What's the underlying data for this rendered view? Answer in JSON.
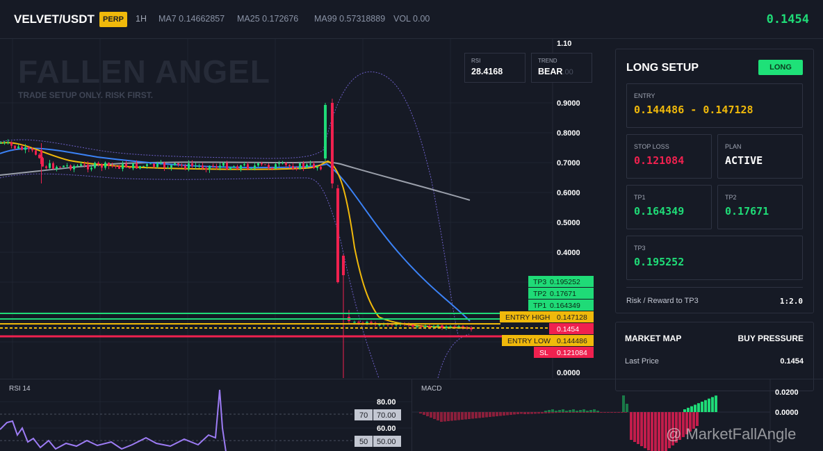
{
  "header": {
    "symbol": "VELVET/USDT",
    "badge": "PERP",
    "timeframe": "1H",
    "ma7": "MA7 0.14662857",
    "ma25": "MA25 0.172676",
    "ma99": "MA99 0.57318889",
    "vol": "VOL 0.00",
    "last_price": "0.1454"
  },
  "chart": {
    "watermark_title": "FALLEN ANGEL",
    "watermark_subtitle": "TRADE SETUP ONLY. RISK FIRST.",
    "rsi_box": {
      "label": "RSI",
      "value": "28.4168"
    },
    "trend_box": {
      "label": "TREND",
      "value": "BEAR",
      "ghost_tick": ".00"
    },
    "price_axis": [
      "1.10",
      "0.9000",
      "0.8000",
      "0.7000",
      "0.6000",
      "0.5000",
      "0.4000",
      "0.0000"
    ],
    "levels": {
      "tp3": {
        "tag": "TP3",
        "value": "0.195252",
        "price": 0.195252
      },
      "tp2": {
        "tag": "TP2",
        "value": "0.17671",
        "price": 0.17671
      },
      "tp1": {
        "tag": "TP1",
        "value": "0.164349",
        "price": 0.164349
      },
      "entry_high": {
        "tag": "ENTRY HIGH",
        "value": "0.147128",
        "price": 0.147128
      },
      "last": {
        "value": "0.1454",
        "price": 0.1454
      },
      "entry_low": {
        "tag": "ENTRY LOW",
        "value": "0.144486",
        "price": 0.144486
      },
      "sl": {
        "tag": "SL",
        "value": "0.121084",
        "price": 0.121084
      }
    },
    "colors": {
      "up": "#1fdb77",
      "down": "#f0214f",
      "ma7": "#f0b90b",
      "ma25": "#3b82f6",
      "ma99": "#9ba0ab",
      "boll": "#6c5fc7"
    }
  },
  "setup": {
    "title": "LONG SETUP",
    "direction_badge": "LONG",
    "entry_label": "ENTRY",
    "entry_value": "0.144486 - 0.147128",
    "sl_label": "STOP LOSS",
    "sl_value": "0.121084",
    "plan_label": "PLAN",
    "plan_value": "ACTIVE",
    "tp1_label": "TP1",
    "tp1_value": "0.164349",
    "tp2_label": "TP2",
    "tp2_value": "0.17671",
    "tp3_label": "TP3",
    "tp3_value": "0.195252",
    "rr_label": "Risk / Reward to TP3",
    "rr_value": "1:2.0"
  },
  "market_map": {
    "title": "MARKET MAP",
    "pressure": "BUY PRESSURE",
    "last_label": "Last Price",
    "last_value": "0.1454"
  },
  "rsi": {
    "title": "RSI 14",
    "ticks": [
      "80.00",
      "60.00"
    ],
    "tag70": "70",
    "val70": "70.00",
    "tag50": "50",
    "val50": "50.00"
  },
  "macd": {
    "title": "MACD",
    "ticks": [
      "0.0200",
      "0.0000"
    ]
  },
  "site_watermark": "@ MarketFallAngle"
}
